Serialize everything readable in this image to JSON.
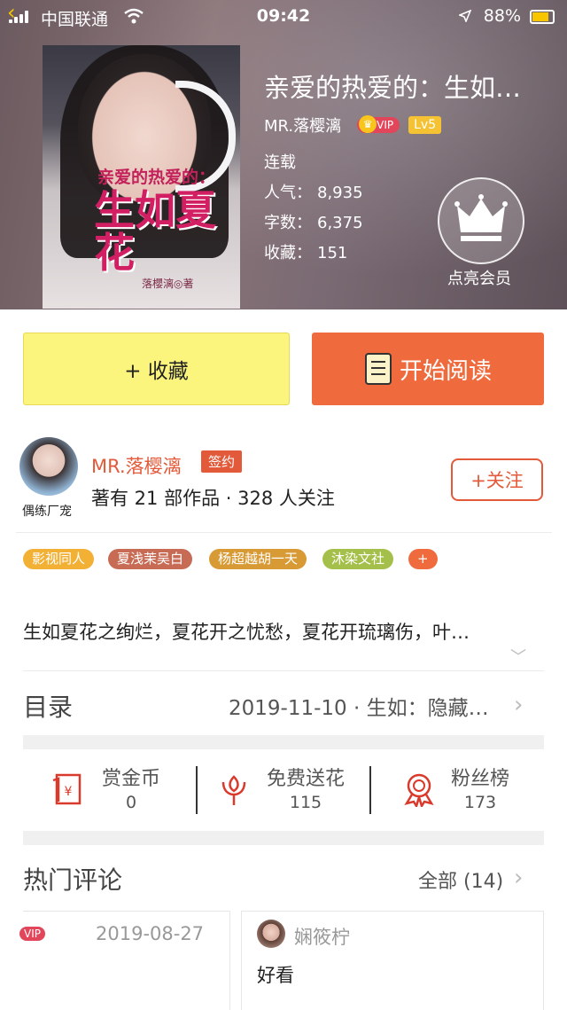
{
  "status_bar": {
    "carrier": "中国联通",
    "time": "09:42",
    "battery": "88%"
  },
  "book": {
    "title": "亲爱的热爱的：生如…",
    "cover_title_top": "亲爱的热爱的：",
    "cover_title": "生如夏花",
    "cover_author": "落櫻漓◎著",
    "author": "MR.落樱漓",
    "vip_badge": "VIP",
    "level_badge": "Lv5",
    "status": "连载",
    "popularity_label": "人气：",
    "popularity": "8,935",
    "words_label": "字数：",
    "words": "6,375",
    "favorites_label": "收藏：",
    "favorites": "151",
    "member_label": "点亮会员"
  },
  "actions": {
    "collect_label": "+ 收藏",
    "read_label": "开始阅读"
  },
  "author_section": {
    "avatar_tag": "偶练厂宠",
    "name": "MR.落樱漓",
    "sign_badge": "签约",
    "stats": "著有 21 部作品 · 328 人关注",
    "follow_label": "+关注"
  },
  "tags": [
    {
      "label": "影视同人",
      "color": "#f2b035"
    },
    {
      "label": "夏浅茉吴白",
      "color": "#c86b55"
    },
    {
      "label": "杨超越胡一天",
      "color": "#d79a34"
    },
    {
      "label": "沐染文社",
      "color": "#a5c04a"
    },
    {
      "label": "+",
      "color": "#ef6b3d"
    }
  ],
  "description": "生如夏花之绚烂，夏花开之忧愁，夏花开琉璃伤，叶…",
  "toc": {
    "label": "目录",
    "latest": "2019-11-10 · 生如：隐藏…"
  },
  "stats": [
    {
      "label": "赏金币",
      "value": "0"
    },
    {
      "label": "免费送花",
      "value": "115"
    },
    {
      "label": "粉丝榜",
      "value": "173"
    }
  ],
  "comments": {
    "label": "热门评论",
    "all_label": "全部 (14)",
    "card1": {
      "vip": "VIP",
      "date": "2019-08-27"
    },
    "card2": {
      "user": "娴筱柠",
      "text": "好看"
    }
  },
  "colors": {
    "accent": "#ef6b3d",
    "author_red": "#e25a3a",
    "collect_yellow": "#fbf57d"
  }
}
